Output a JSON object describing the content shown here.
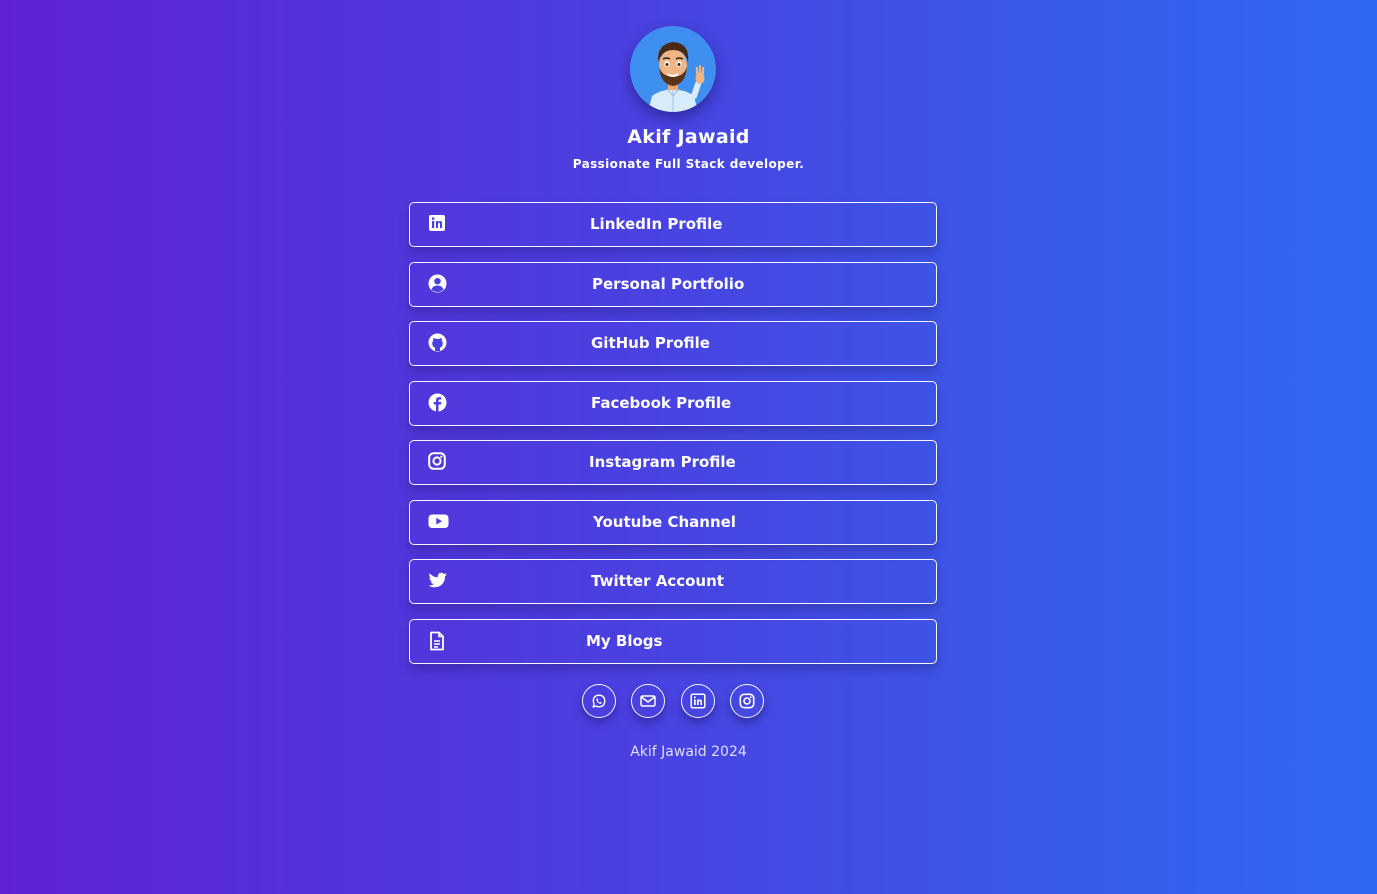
{
  "profile": {
    "name": "Akif Jawaid",
    "tagline": "Passionate Full Stack developer.",
    "avatar_icon": "bitmoji-avatar-waving"
  },
  "links": [
    {
      "label": "LinkedIn Profile",
      "icon": "linkedin-icon"
    },
    {
      "label": "Personal Portfolio",
      "icon": "user-circle-icon"
    },
    {
      "label": "GitHub Profile",
      "icon": "github-icon"
    },
    {
      "label": "Facebook Profile",
      "icon": "facebook-icon"
    },
    {
      "label": "Instagram Profile",
      "icon": "instagram-icon"
    },
    {
      "label": "Youtube Channel",
      "icon": "youtube-icon"
    },
    {
      "label": "Twitter Account",
      "icon": "twitter-icon"
    },
    {
      "label": "My Blogs",
      "icon": "document-icon"
    }
  ],
  "social": [
    {
      "icon": "whatsapp-icon"
    },
    {
      "icon": "envelope-icon"
    },
    {
      "icon": "linkedin-icon"
    },
    {
      "icon": "instagram-icon"
    }
  ],
  "footer": {
    "text": "Akif Jawaid 2024"
  },
  "colors": {
    "gradient_start": "#5f22d2",
    "gradient_end": "#2f68f4",
    "avatar_bg": "#3f8ff0",
    "text": "#ffffff"
  }
}
